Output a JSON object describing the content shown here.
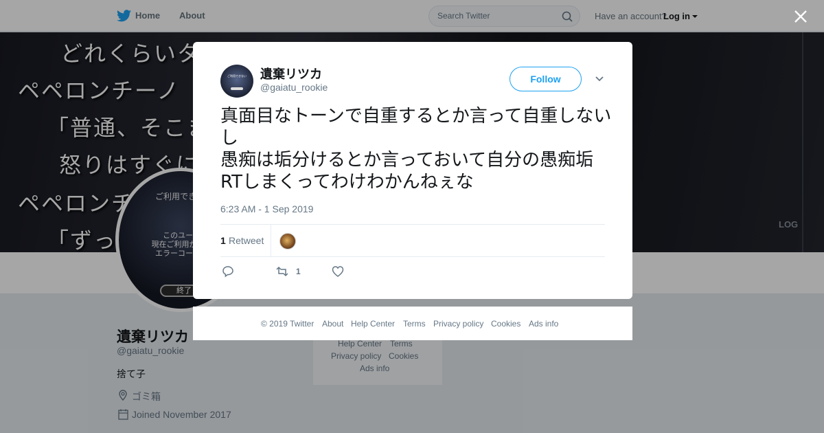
{
  "nav": {
    "home_label": "Home",
    "about_label": "About",
    "search_placeholder": "Search Twitter",
    "have_account": "Have an account?",
    "login_label": "Log in"
  },
  "banner": {
    "lines": [
      "どれくらいタイミング...",
      "ペペロンチーノ",
      "「普通、そこま",
      "怒りはすぐに",
      "ペペロンチ",
      "「ずっと"
    ],
    "side_label": "LOG"
  },
  "background_profile": {
    "avatar_text_top": "ご利用できない",
    "avatar_text_mid": "このユーザー\n現在ご利用が停止さ\nエラーコード: 97-",
    "avatar_button": "終了",
    "name": "遺棄リツカ",
    "handle": "@gaiatu_rookie",
    "bio": "捨て子",
    "location": "ゴミ箱",
    "joined": "Joined November 2017",
    "footer_links": [
      "Help Center",
      "Terms",
      "Privacy policy",
      "Cookies",
      "Ads info"
    ]
  },
  "tweet": {
    "name": "遺棄リツカ",
    "handle": "@gaiatu_rookie",
    "follow_label": "Follow",
    "text": "真面目なトーンで自重するとか言って自重しないし\n愚痴は垢分けるとか言っておいて自分の愚痴垢RTしまくってわけわかんねぇな",
    "timestamp": "6:23 AM - 1 Sep 2019",
    "retweet_count": "1",
    "retweet_label": "Retweet",
    "action_retweet_count": "1"
  },
  "modal_footer": {
    "copyright": "© 2019 Twitter",
    "links": [
      "About",
      "Help Center",
      "Terms",
      "Privacy policy",
      "Cookies",
      "Ads info"
    ]
  },
  "colors": {
    "twitter_blue": "#1da1f2",
    "muted_text": "#657786",
    "background": "#e6ecf0"
  },
  "icons": [
    "twitter-bird-icon",
    "search-icon",
    "close-icon",
    "chevron-down-icon",
    "reply-icon",
    "retweet-icon",
    "like-icon",
    "location-icon",
    "calendar-icon"
  ]
}
